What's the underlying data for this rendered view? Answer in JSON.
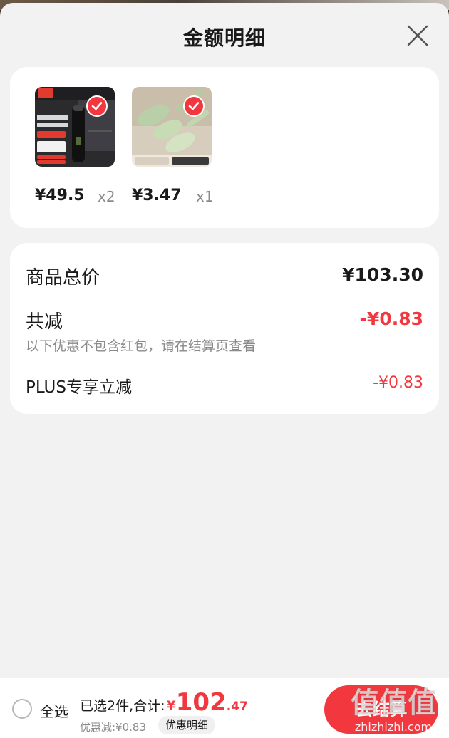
{
  "sheet": {
    "title": "金额明细"
  },
  "products": [
    {
      "price_int": "¥49",
      "price_dec": ".5",
      "qty": "x2",
      "image_icon": "thermos-bottle-image"
    },
    {
      "price_int": "¥3",
      "price_dec": ".47",
      "qty": "x1",
      "image_icon": "ceramic-spoons-image"
    }
  ],
  "summary": {
    "total_label": "商品总价",
    "total_value": "¥103.30",
    "reduce_label": "共减",
    "reduce_value": "-¥0.83",
    "note": "以下优惠不包含红包，请在结算页查看",
    "plus_label": "PLUS专享立减",
    "plus_value": "-¥0.83"
  },
  "bottom_bar": {
    "select_all": "全选",
    "total_prefix": "已选2件,合计:",
    "currency": "¥",
    "total_int": "102",
    "total_dec": ".47",
    "discount": "优惠减:¥0.83",
    "detail_chip": "优惠明细",
    "checkout": "去结算"
  },
  "watermark": {
    "text": "值值值",
    "url": "zhizhizhi.com"
  },
  "colors": {
    "accent_red": "#f2373f",
    "card_bg": "#ffffff",
    "sheet_bg": "#f2f2f2",
    "muted_text": "#8a8a8a"
  }
}
